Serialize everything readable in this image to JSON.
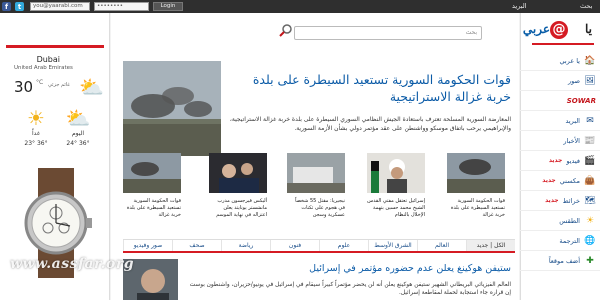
{
  "topbar": {
    "facebook": "f",
    "twitter": "t",
    "email_value": "you@yaarabi.com",
    "password_value": "••••••••",
    "login_label": "Login",
    "link_register": "البريد",
    "link_search": "بحث"
  },
  "logo": {
    "part1": "يا",
    "part2": "عربي",
    "symbol": "@"
  },
  "nav": [
    {
      "label": "يا عربي",
      "icon": "home-icon"
    },
    {
      "label": "صور",
      "icon": "photos-icon"
    },
    {
      "label": "SOWAR",
      "icon": "sowar-icon"
    },
    {
      "label": "البريد",
      "icon": "mail-icon"
    },
    {
      "label": "الأخبار",
      "icon": "news-icon"
    },
    {
      "label": "فيديو",
      "badge": "جديد",
      "icon": "video-icon"
    },
    {
      "label": "مكسني",
      "badge": "جديد",
      "icon": "bag-icon"
    },
    {
      "label": "خرائط",
      "badge": "جديد",
      "icon": "map-icon"
    },
    {
      "label": "الطقس",
      "icon": "weather-icon"
    },
    {
      "label": "الترجمة",
      "icon": "translate-icon"
    },
    {
      "label": "أضف موقعاً",
      "icon": "add-site-icon"
    }
  ],
  "weather": {
    "city": "Dubai",
    "country": "United Arab Emirates",
    "temp": "30",
    "unit": "°C",
    "note": "غائم جزئي",
    "tomorrow": "غداً",
    "today": "اليوم",
    "tomorrow_range": "23° 36°",
    "today_range": "24° 36°"
  },
  "search": {
    "placeholder": "بحث"
  },
  "hero": {
    "title": "قوات الحكومة السورية تستعيد السيطرة على بلدة خربة غزالة الاستراتيجية",
    "text": "المعارضة السورية المسلحة تعترف باستعادة الجيش النظامي السوري السيطرة على بلدة خربة غزالة الاستراتيجية، والإبراهيمي يرحب باتفاق موسكو وواشنطن على عقد مؤتمر دولي بشأن الأزمة السورية."
  },
  "thumbs": [
    {
      "caption": "قوات الحكومة السورية تستعيد السيطرة على بلدة خربة غزالة"
    },
    {
      "caption": "إسرائيل تعتقل مفتي القدس الشيخ محمد حسين بتهمة الإخلال بالنظام"
    },
    {
      "caption": "نيجيريا: مقتل 55 شخصاً في هجوم على ثكنات عسكرية وسجن"
    },
    {
      "caption": "أليكس فيرجسون مدرب مانشستر يونايتد يعلن اعتزاله في نهاية الموسم"
    },
    {
      "caption": "قوات الحكومة السورية تستعيد السيطرة على بلدة خربة غزالة"
    }
  ],
  "tabs": [
    "الكل | جديد",
    "العالم",
    "الشرق الأوسط",
    "علوم",
    "فنون",
    "رياضة",
    "صحف",
    "صور وفيديو"
  ],
  "news": {
    "title": "ستيفن هوكينغ يعلن عدم حضوره مؤتمر في إسرائيل",
    "text": "العالم الفيزيائي البريطاني الشهير ستيفن هوكينغ يعلن أنه لن يحضر مؤتمراً كبيراً سيقام في إسرائيل في يونيو/حزيران، واشنطون بوست إن قراره جاء استجابة لحملة لمقاطعة إسرائيل."
  },
  "watermark": "www.assfar.org"
}
